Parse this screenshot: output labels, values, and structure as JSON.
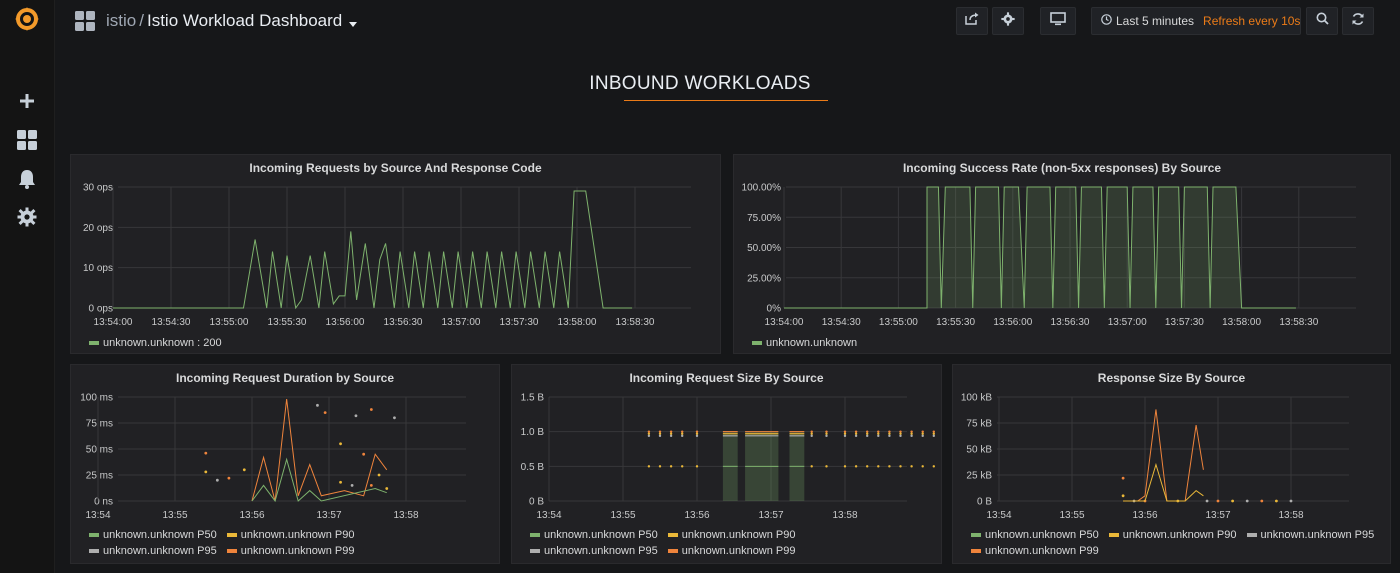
{
  "header": {
    "folder": "istio",
    "separator": "/",
    "title": "Istio Workload Dashboard",
    "time_range": "Last 5 minutes",
    "refresh": "Refresh every 10s"
  },
  "sidebar": {
    "items": [
      "create-icon",
      "dashboards-icon",
      "alerting-icon",
      "configuration-icon"
    ]
  },
  "toolbar": {
    "buttons": [
      "share-icon",
      "settings-icon",
      "tv-mode-icon",
      "search-icon",
      "refresh-icon"
    ]
  },
  "row_title": "INBOUND WORKLOADS",
  "colors": {
    "green": "#7eb26d",
    "orange": "#eab839",
    "darkorange": "#ef843c",
    "grey": "#aeaeae",
    "accent": "#eb7b18"
  },
  "panels": [
    {
      "title": "Incoming Requests by Source And Response Code",
      "legend": [
        {
          "name": "unknown.unknown : 200",
          "color": "#7eb26d"
        }
      ],
      "chart_data": {
        "type": "line",
        "ylabels": [
          "30 ops",
          "20 ops",
          "10 ops",
          "0 ops"
        ],
        "ylim": [
          0,
          30
        ],
        "xlabels": [
          "13:54:00",
          "13:54:30",
          "13:55:00",
          "13:55:30",
          "13:56:00",
          "13:56:30",
          "13:57:00",
          "13:57:30",
          "13:58:00",
          "13:58:30"
        ],
        "xrange_min": [
          0,
          5.75
        ],
        "series": [
          {
            "name": "unknown.unknown : 200",
            "points": [
              [
                0,
                0
              ],
              [
                2.25,
                0
              ],
              [
                2.45,
                17
              ],
              [
                2.65,
                0
              ],
              [
                2.75,
                14
              ],
              [
                2.9,
                0
              ],
              [
                3.0,
                13
              ],
              [
                3.15,
                0
              ],
              [
                3.25,
                2
              ],
              [
                3.4,
                13
              ],
              [
                3.55,
                0
              ],
              [
                3.65,
                14
              ],
              [
                3.8,
                1
              ],
              [
                3.9,
                3
              ],
              [
                4.0,
                3
              ],
              [
                4.1,
                19
              ],
              [
                4.2,
                2
              ],
              [
                4.35,
                16
              ],
              [
                4.5,
                0
              ],
              [
                4.6,
                12
              ],
              [
                4.7,
                16
              ],
              [
                4.85,
                0
              ],
              [
                4.95,
                14
              ],
              [
                5.1,
                0
              ],
              [
                5.2,
                14
              ],
              [
                5.35,
                0
              ],
              [
                5.45,
                14
              ],
              [
                5.6,
                0
              ],
              [
                5.7,
                14
              ],
              [
                5.85,
                0
              ],
              [
                5.95,
                14
              ],
              [
                6.1,
                0
              ],
              [
                6.2,
                14
              ],
              [
                6.35,
                0
              ],
              [
                6.45,
                14
              ],
              [
                6.6,
                0
              ],
              [
                6.7,
                14
              ],
              [
                6.85,
                0
              ],
              [
                6.95,
                14
              ],
              [
                7.1,
                0
              ],
              [
                7.2,
                14
              ],
              [
                7.35,
                0
              ],
              [
                7.45,
                14
              ],
              [
                7.6,
                0
              ],
              [
                7.7,
                14
              ],
              [
                7.85,
                0
              ],
              [
                7.95,
                29
              ],
              [
                8.15,
                29
              ],
              [
                8.45,
                0
              ],
              [
                8.95,
                0
              ]
            ]
          }
        ]
      }
    },
    {
      "title": "Incoming Success Rate (non-5xx responses) By Source",
      "legend": [
        {
          "name": "unknown.unknown",
          "color": "#7eb26d"
        }
      ],
      "chart_data": {
        "type": "line",
        "ylabels": [
          "100.00%",
          "75.00%",
          "50.00%",
          "25.00%",
          "0%"
        ],
        "ylim": [
          0,
          100
        ],
        "xlabels": [
          "13:54:00",
          "13:54:30",
          "13:55:00",
          "13:55:30",
          "13:56:00",
          "13:56:30",
          "13:57:00",
          "13:57:30",
          "13:58:00",
          "13:58:30"
        ],
        "series": [
          {
            "name": "unknown.unknown",
            "points": [
              [
                0,
                0
              ],
              [
                2.5,
                0
              ],
              [
                2.5,
                100
              ],
              [
                2.7,
                100
              ],
              [
                2.75,
                0
              ],
              [
                2.82,
                100
              ],
              [
                3.25,
                100
              ],
              [
                3.3,
                0
              ],
              [
                3.35,
                100
              ],
              [
                3.75,
                100
              ],
              [
                3.8,
                0
              ],
              [
                3.85,
                100
              ],
              [
                4.1,
                100
              ],
              [
                4.2,
                0
              ],
              [
                4.25,
                100
              ],
              [
                4.65,
                100
              ],
              [
                4.7,
                0
              ],
              [
                4.75,
                100
              ],
              [
                5.1,
                100
              ],
              [
                5.15,
                0
              ],
              [
                5.2,
                100
              ],
              [
                5.55,
                100
              ],
              [
                5.6,
                0
              ],
              [
                5.65,
                100
              ],
              [
                6.0,
                100
              ],
              [
                6.05,
                0
              ],
              [
                6.1,
                100
              ],
              [
                6.45,
                100
              ],
              [
                6.5,
                0
              ],
              [
                6.55,
                100
              ],
              [
                6.9,
                100
              ],
              [
                6.95,
                0
              ],
              [
                7.0,
                100
              ],
              [
                7.4,
                100
              ],
              [
                7.45,
                0
              ],
              [
                7.5,
                100
              ],
              [
                7.9,
                100
              ],
              [
                8.0,
                0
              ],
              [
                8.95,
                0
              ]
            ]
          }
        ]
      }
    },
    {
      "title": "Incoming Request Duration by Source",
      "legend": [
        {
          "name": "unknown.unknown P50",
          "color": "#7eb26d"
        },
        {
          "name": "unknown.unknown P90",
          "color": "#eab839"
        },
        {
          "name": "unknown.unknown P95",
          "color": "#aeaeae"
        },
        {
          "name": "unknown.unknown P99",
          "color": "#ef843c"
        }
      ],
      "chart_data": {
        "type": "line",
        "ylabels": [
          "100 ms",
          "75 ms",
          "50 ms",
          "25 ms",
          "0 ns"
        ],
        "ylim": [
          0,
          100
        ],
        "xlabels": [
          "13:54",
          "13:55",
          "13:56",
          "13:57",
          "13:58"
        ],
        "series": [
          {
            "name": "unknown.unknown P99",
            "points": [
              [
                2.0,
                0
              ],
              [
                2.15,
                42
              ],
              [
                2.3,
                0
              ],
              [
                2.45,
                98
              ],
              [
                2.6,
                5
              ],
              [
                2.75,
                35
              ],
              [
                2.9,
                5
              ],
              [
                3.2,
                10
              ],
              [
                3.45,
                5
              ],
              [
                3.6,
                45
              ],
              [
                3.75,
                30
              ]
            ]
          },
          {
            "name": "unknown.unknown P50",
            "points": [
              [
                2.0,
                0
              ],
              [
                2.15,
                15
              ],
              [
                2.3,
                0
              ],
              [
                2.45,
                40
              ],
              [
                2.6,
                0
              ],
              [
                2.75,
                10
              ],
              [
                2.9,
                0
              ],
              [
                3.6,
                12
              ],
              [
                3.75,
                8
              ]
            ]
          }
        ]
      }
    },
    {
      "title": "Incoming Request Size By Source",
      "legend": [
        {
          "name": "unknown.unknown P50",
          "color": "#7eb26d"
        },
        {
          "name": "unknown.unknown P90",
          "color": "#eab839"
        },
        {
          "name": "unknown.unknown P95",
          "color": "#aeaeae"
        },
        {
          "name": "unknown.unknown P99",
          "color": "#ef843c"
        }
      ],
      "chart_data": {
        "type": "area",
        "ylabels": [
          "1.5 B",
          "1.0 B",
          "0.5 B",
          "0 B"
        ],
        "ylim": [
          0,
          1.5
        ],
        "xlabels": [
          "13:54",
          "13:55",
          "13:56",
          "13:57",
          "13:58"
        ]
      }
    },
    {
      "title": "Response Size By Source",
      "legend": [
        {
          "name": "unknown.unknown P50",
          "color": "#7eb26d"
        },
        {
          "name": "unknown.unknown P90",
          "color": "#eab839"
        },
        {
          "name": "unknown.unknown P95",
          "color": "#aeaeae"
        },
        {
          "name": "unknown.unknown P99",
          "color": "#ef843c"
        }
      ],
      "chart_data": {
        "type": "line",
        "ylabels": [
          "100 kB",
          "75 kB",
          "50 kB",
          "25 kB",
          "0 B"
        ],
        "ylim": [
          0,
          100
        ],
        "xlabels": [
          "13:54",
          "13:55",
          "13:56",
          "13:57",
          "13:58"
        ],
        "series": [
          {
            "name": "unknown.unknown P99",
            "points": [
              [
                1.7,
                0
              ],
              [
                1.9,
                0
              ],
              [
                2.0,
                5
              ],
              [
                2.15,
                88
              ],
              [
                2.3,
                0
              ],
              [
                2.55,
                0
              ],
              [
                2.7,
                73
              ],
              [
                2.8,
                30
              ]
            ]
          },
          {
            "name": "unknown.unknown P90",
            "points": [
              [
                1.7,
                0
              ],
              [
                2.0,
                0
              ],
              [
                2.15,
                35
              ],
              [
                2.3,
                0
              ],
              [
                2.55,
                0
              ],
              [
                2.7,
                10
              ],
              [
                2.8,
                5
              ]
            ]
          }
        ]
      }
    }
  ]
}
